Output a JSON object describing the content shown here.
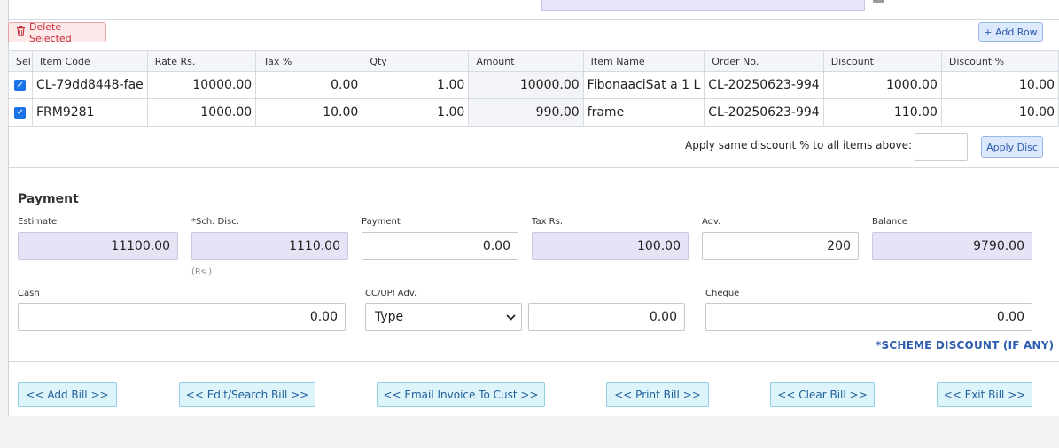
{
  "toolbar": {
    "delete_label": "Delete Selected",
    "add_row_label": "+ Add Row"
  },
  "table": {
    "headers": [
      "Sel",
      "Item Code",
      "Rate Rs.",
      "Tax %",
      "Qty",
      "Amount",
      "Item Name",
      "Order No.",
      "Discount",
      "Discount %"
    ],
    "rows": [
      {
        "checked": true,
        "item_code": "CL-79dd8448-fae",
        "rate": "10000.00",
        "tax": "0.00",
        "qty": "1.00",
        "amount": "10000.00",
        "item_name": "FibonaaciSat a 1 L",
        "order_no": "CL-20250623-994",
        "discount": "1000.00",
        "discount_pct": "10.00"
      },
      {
        "checked": true,
        "item_code": "FRM9281",
        "rate": "1000.00",
        "tax": "10.00",
        "qty": "1.00",
        "amount": "990.00",
        "item_name": "frame",
        "order_no": "CL-20250623-994",
        "discount": "110.00",
        "discount_pct": "10.00"
      }
    ]
  },
  "apply": {
    "label": "Apply same discount % to all items above:",
    "value": "",
    "button": "Apply Disc"
  },
  "payment": {
    "title": "Payment",
    "estimate_label": "Estimate",
    "estimate": "11100.00",
    "sch_disc_label": "*Sch. Disc.",
    "sch_disc": "1110.00",
    "sch_disc_unit": "(Rs.)",
    "payment_label": "Payment",
    "payment": "0.00",
    "tax_label": "Tax Rs.",
    "tax": "100.00",
    "adv_label": "Adv.",
    "adv": "200",
    "balance_label": "Balance",
    "balance": "9790.00",
    "cash_label": "Cash",
    "cash": "0.00",
    "cc_label": "CC/UPI Adv.",
    "cc_type": "Type",
    "cc_amount": "0.00",
    "cheque_label": "Cheque",
    "cheque": "0.00",
    "scheme_note": "*SCHEME DISCOUNT (IF ANY)"
  },
  "actions": {
    "add_bill": "<< Add Bill >>",
    "edit_bill": "<< Edit/Search Bill >>",
    "email_invoice": "<< Email Invoice To Cust >>",
    "print_bill": "<< Print Bill >>",
    "clear_bill": "<< Clear Bill >>",
    "exit_bill": "<< Exit Bill >>"
  },
  "colors": {
    "readonly_bg": "#e5e4f6",
    "action_bg": "#ddf4fb",
    "delete_red": "#c62f3a",
    "link_blue": "#2c5cb0"
  }
}
